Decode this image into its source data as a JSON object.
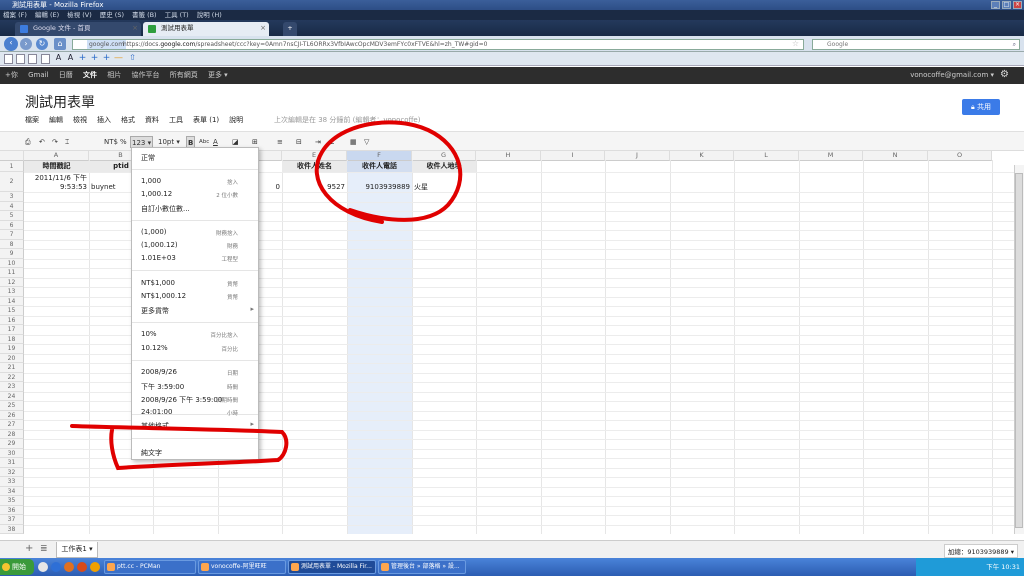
{
  "window": {
    "title": "測試用表單 - Mozilla Firefox"
  },
  "menubar": [
    "檔案 (F)",
    "編輯 (E)",
    "檢視 (V)",
    "歷史 (S)",
    "書籤 (B)",
    "工具 (T)",
    "說明 (H)"
  ],
  "tabs": [
    {
      "label": "Google 文件 - 首頁",
      "active": false
    },
    {
      "label": "測試用表單",
      "active": true
    }
  ],
  "nav": {
    "url_domain": "google.com",
    "url_prefix": "https://docs.",
    "url_rest": "/spreadsheet/ccc?key=0Amn7nsCJI-TL6ORRx3VfbIAwcOpcMDV3emFYc0xFTVE&hl=zh_TW#gid=0",
    "search_placeholder": "Google"
  },
  "gbar": {
    "items": [
      "+你",
      "Gmail",
      "日曆",
      "文件",
      "相片",
      "協作平台",
      "所有網頁",
      "更多 ▾"
    ],
    "active_index": 3,
    "user": "vonocoffe@gmail.com ▾"
  },
  "doc": {
    "title": "測試用表單",
    "menu": [
      "檔案",
      "編輯",
      "檢視",
      "插入",
      "格式",
      "資料",
      "工具",
      "表單 (1)",
      "說明"
    ],
    "last_edit": "上次編輯是在 38 分鐘前 (編輯者：vonocoffe)",
    "share_label": "共用"
  },
  "toolbar": {
    "currency": "NT$",
    "percent": "%",
    "number_format": "123 ▾",
    "font_size": "10pt ▾",
    "bold": "B",
    "abc": "Abc",
    "font_color": "A"
  },
  "grid": {
    "columns": [
      "A",
      "B",
      "C",
      "D",
      "E",
      "F",
      "G",
      "H",
      "I",
      "J",
      "K",
      "L",
      "M",
      "N",
      "O"
    ],
    "rows": [
      "1",
      "2",
      "3",
      "4",
      "5",
      "6",
      "7",
      "8",
      "9",
      "10",
      "11",
      "12",
      "13",
      "14",
      "15",
      "16",
      "17",
      "18",
      "19",
      "20",
      "21",
      "22",
      "23",
      "24",
      "25",
      "26",
      "27",
      "28",
      "29",
      "30",
      "31",
      "32",
      "33",
      "34",
      "35",
      "36",
      "37",
      "38"
    ],
    "row1": {
      "A": "時間戳記",
      "B": "ptid",
      "E": "收件人姓名",
      "F": "收件人電話",
      "G": "收件人地址"
    },
    "row2": {
      "A_line1": "2011/11/6 下午",
      "A_line2": "9:53:53",
      "B": "buynet",
      "D": "0",
      "E": "9527",
      "F": "9103939889",
      "G": "火星"
    }
  },
  "format_menu": {
    "items": [
      {
        "label": "正常",
        "hint": ""
      },
      {
        "label": "1,000",
        "hint": "捨入"
      },
      {
        "label": "1,000.12",
        "hint": "2 位小數"
      },
      {
        "label": "自訂小數位數...",
        "hint": ""
      },
      {
        "label": "(1,000)",
        "hint": "財務捨入"
      },
      {
        "label": "(1,000.12)",
        "hint": "財務"
      },
      {
        "label": "1.01E+03",
        "hint": "工程型"
      },
      {
        "label": "NT$1,000",
        "hint": "貨幣"
      },
      {
        "label": "NT$1,000.12",
        "hint": "貨幣"
      },
      {
        "label": "更多貨幣",
        "hint": "▸"
      },
      {
        "label": "10%",
        "hint": "百分比捨入"
      },
      {
        "label": "10.12%",
        "hint": "百分比"
      },
      {
        "label": "2008/9/26",
        "hint": "日期"
      },
      {
        "label": "下午 3:59:00",
        "hint": "時間"
      },
      {
        "label": "2008/9/26 下午 3:59:00",
        "hint": "日期時間"
      },
      {
        "label": "24:01:00",
        "hint": "小時"
      },
      {
        "label": "其他格式",
        "hint": "▸"
      },
      {
        "label": "純文字",
        "hint": ""
      }
    ]
  },
  "sheets": {
    "tab": "工作表1 ▾",
    "summary": "加總：9103939889 ▾"
  },
  "taskbar": {
    "start": "開始",
    "buttons": [
      {
        "label": "ptt.cc - PCMan",
        "active": false
      },
      {
        "label": "vonocoffe-阿里旺旺",
        "active": false
      },
      {
        "label": "測試用表單 - Mozilla Fir...",
        "active": true
      },
      {
        "label": "管理後台 » 部落格 » 設...",
        "active": false
      }
    ],
    "clock": "下午 10:31"
  },
  "colors": {
    "accent": "#3b7be8",
    "annotation": "#e00000",
    "selected_column": "#e6eefa"
  }
}
